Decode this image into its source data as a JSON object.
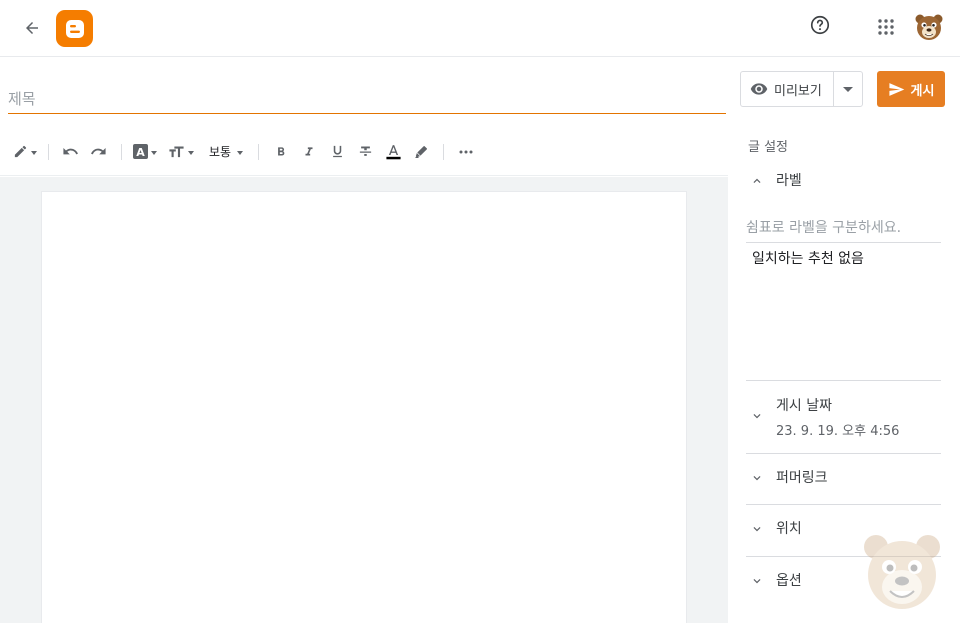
{
  "topbar": {
    "back_icon": "arrow-back-icon",
    "logo_icon": "blogger-logo-icon",
    "help_icon": "help-circle-icon",
    "apps_icon": "apps-grid-icon",
    "avatar_icon": "bear-avatar-icon",
    "brand_color": "#f57d00"
  },
  "title": {
    "placeholder": "제목",
    "value": ""
  },
  "toolbar": {
    "font_size_label": "보통",
    "icons": [
      "pencil-icon",
      "undo-icon",
      "redo-icon",
      "font-icon",
      "text-size-icon",
      "bold-icon",
      "italic-icon",
      "underline-icon",
      "strikethrough-icon",
      "text-color-icon",
      "highlight-icon",
      "more-icon"
    ]
  },
  "actions": {
    "preview_label": "미리보기",
    "publish_label": "게시",
    "publish_color": "#e67e22"
  },
  "sidebar": {
    "title": "글 설정",
    "labels": {
      "label": "라벨",
      "placeholder": "쉼표로 라벨을 구분하세요.",
      "no_match": "일치하는 추천 없음"
    },
    "publish_date": {
      "label": "게시 날짜",
      "value": "23. 9. 19. 오후 4:56"
    },
    "permalink": {
      "label": "퍼머링크"
    },
    "location": {
      "label": "위치"
    },
    "options": {
      "label": "옵션"
    }
  }
}
